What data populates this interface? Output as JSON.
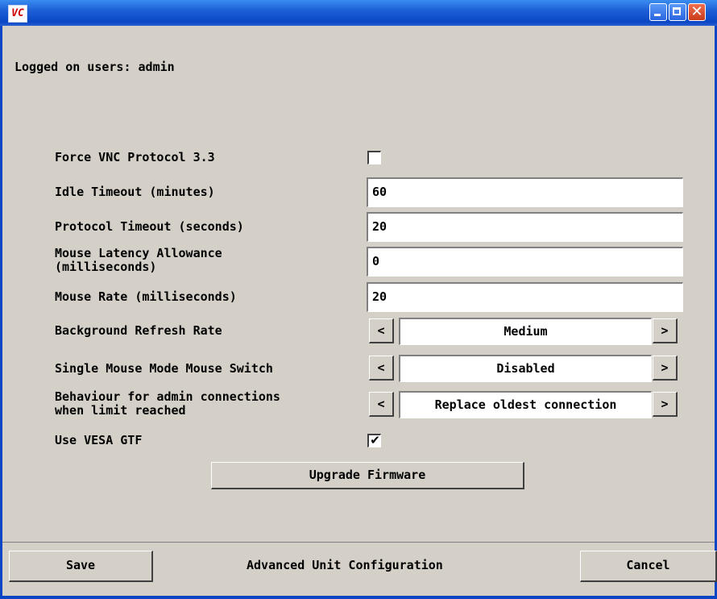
{
  "window": {
    "icon_text": "VC"
  },
  "logged_on_users": "Logged on users:  admin",
  "settings": {
    "force_vnc_label": "Force VNC Protocol 3.3",
    "force_vnc_checked": false,
    "idle_timeout_label": "Idle Timeout (minutes)",
    "idle_timeout_value": "60",
    "protocol_timeout_label": "Protocol Timeout (seconds)",
    "protocol_timeout_value": "20",
    "mouse_latency_label_1": "Mouse Latency Allowance",
    "mouse_latency_label_2": "(milliseconds)",
    "mouse_latency_value": "0",
    "mouse_rate_label": "Mouse Rate (milliseconds)",
    "mouse_rate_value": "20",
    "background_refresh_label": "Background Refresh Rate",
    "background_refresh_value": "Medium",
    "single_mouse_label": "Single Mouse Mode Mouse Switch",
    "single_mouse_value": "Disabled",
    "behaviour_label_1": "Behaviour for admin connections",
    "behaviour_label_2": "when limit reached",
    "behaviour_value": "Replace oldest connection",
    "vesa_label": "Use VESA GTF",
    "vesa_checked": true,
    "prev_arrow": "<",
    "next_arrow": ">"
  },
  "upgrade_label": "Upgrade Firmware",
  "footer": {
    "save_label": "Save",
    "title": "Advanced Unit Configuration",
    "cancel_label": "Cancel"
  },
  "icons": {
    "check_glyph": "✔",
    "close_glyph": "✕"
  }
}
